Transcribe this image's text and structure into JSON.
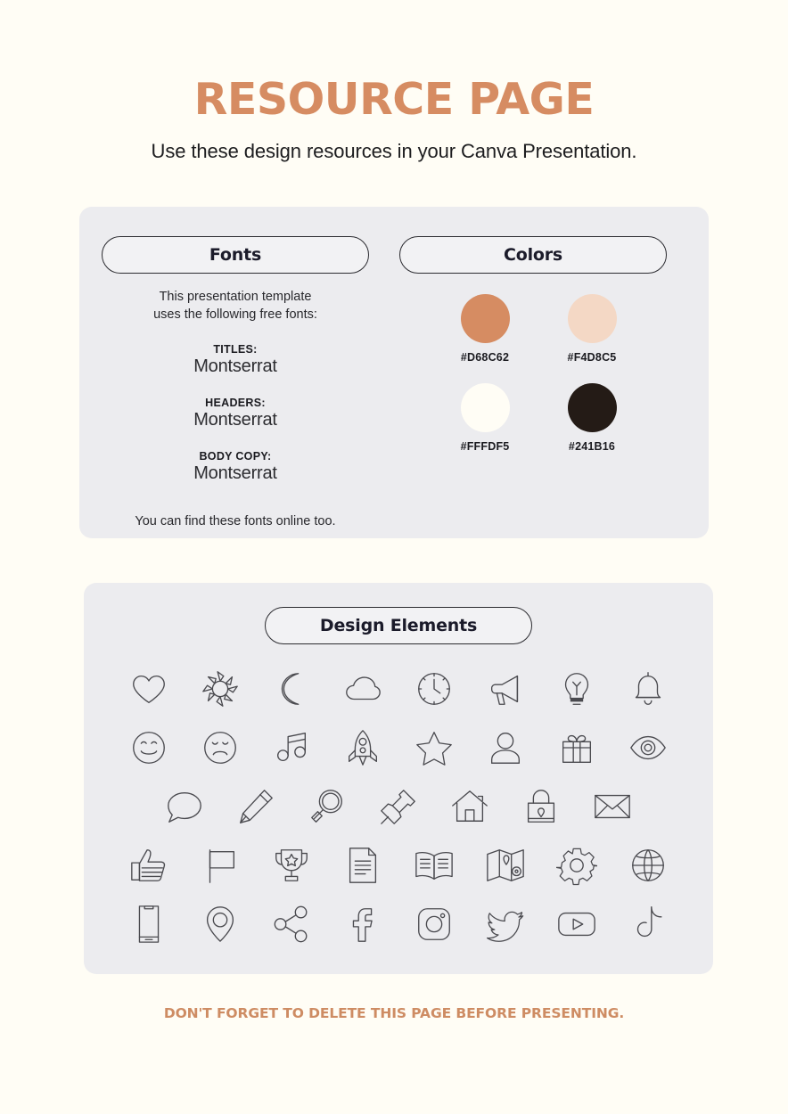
{
  "header": {
    "title": "RESOURCE PAGE",
    "subtitle": "Use these design resources in your Canva Presentation."
  },
  "fonts_card": {
    "fonts_heading": "Fonts",
    "intro_line_1": "This presentation template",
    "intro_line_2": "uses the following free fonts:",
    "groups": [
      {
        "role": "TITLES:",
        "name": "Montserrat"
      },
      {
        "role": "HEADERS:",
        "name": "Montserrat"
      },
      {
        "role": "BODY COPY:",
        "name": "Montserrat"
      }
    ],
    "footnote": "You can find these fonts online too."
  },
  "colors_card": {
    "colors_heading": "Colors",
    "swatches": [
      {
        "hex": "#D68C62",
        "label": "#D68C62"
      },
      {
        "hex": "#F4D8C5",
        "label": "#F4D8C5"
      },
      {
        "hex": "#FFFDF5",
        "label": "#FFFDF5"
      },
      {
        "hex": "#241B16",
        "label": "#241B16"
      }
    ]
  },
  "design_elements_card": {
    "heading": "Design Elements",
    "rows": [
      [
        "heart-icon",
        "sun-icon",
        "moon-icon",
        "cloud-icon",
        "clock-icon",
        "megaphone-icon",
        "lightbulb-icon",
        "bell-icon"
      ],
      [
        "smiley-face-icon",
        "sad-face-icon",
        "music-note-icon",
        "rocket-icon",
        "star-icon",
        "person-icon",
        "gift-icon",
        "eye-icon"
      ],
      [
        "speech-bubble-icon",
        "pencil-icon",
        "magnifier-icon",
        "pushpin-icon",
        "house-icon",
        "lock-icon",
        "envelope-icon"
      ],
      [
        "thumbs-up-icon",
        "flag-icon",
        "trophy-icon",
        "document-icon",
        "open-book-icon",
        "map-icon",
        "gear-icon",
        "globe-icon"
      ],
      [
        "phone-icon",
        "location-pin-icon",
        "share-icon",
        "facebook-icon",
        "instagram-icon",
        "twitter-icon",
        "youtube-icon",
        "tiktok-icon"
      ]
    ]
  },
  "footer": {
    "note": "DON'T FORGET TO DELETE THIS PAGE BEFORE PRESENTING."
  },
  "theme": {
    "page_background": "#FFFDF5",
    "card_background": "#ECECEF",
    "accent": "#D68C62",
    "ink": "#241B16"
  }
}
